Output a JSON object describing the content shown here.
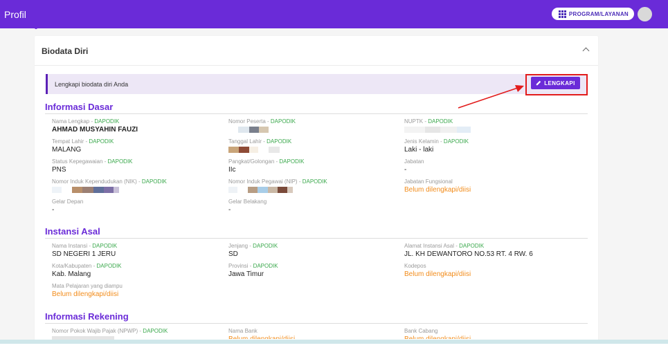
{
  "topbar": {
    "title": "Profil",
    "program_button": "PROGRAM/LAYANAN",
    "program_icon": "grid-icon",
    "avatar_icon": "avatar"
  },
  "card": {
    "title": "Biodata Diri",
    "alert_text": "Lengkapi biodata diri Anda",
    "lengkapi_label": "LENGKAPI",
    "lengkapi_icon": "pencil-icon"
  },
  "colors": {
    "primary": "#6a2bd8",
    "source_green": "#3aa84c",
    "warning_orange": "#f28c1b",
    "annotation_red": "#e21b1b"
  },
  "sections": {
    "informasi_dasar": {
      "title": "Informasi Dasar",
      "fields": {
        "nama_lengkap": {
          "label": "Nama Lengkap",
          "source": "DAPODIK",
          "value": "AHMAD MUSYAHIN FAUZI"
        },
        "nomor_peserta": {
          "label": "Nomor Peserta",
          "source": "DAPODIK",
          "value": ""
        },
        "nuptk": {
          "label": "NUPTK",
          "source": "DAPODIK",
          "value": ""
        },
        "tempat_lahir": {
          "label": "Tempat Lahir",
          "source": "DAPODIK",
          "value": "MALANG"
        },
        "tanggal_lahir": {
          "label": "Tanggal Lahir",
          "source": "DAPODIK",
          "value": ""
        },
        "jenis_kelamin": {
          "label": "Jenis Kelamin",
          "source": "DAPODIK",
          "value": "Laki - laki"
        },
        "status_kepegawaian": {
          "label": "Status Kepegawaian",
          "source": "DAPODIK",
          "value": "PNS"
        },
        "pangkat": {
          "label": "Pangkat/Golongan",
          "source": "DAPODIK",
          "value": "IIc"
        },
        "jabatan": {
          "label": "Jabatan",
          "value": "-"
        },
        "nik": {
          "label": "Nomor Induk Kependudukan (NIK)",
          "source": "DAPODIK",
          "value": ""
        },
        "nip": {
          "label": "Nomor Induk Pegawai (NIP)",
          "source": "DAPODIK",
          "value": ""
        },
        "jabatan_fungsional": {
          "label": "Jabatan Fungsional",
          "value": "Belum dilengkapi/diisi"
        },
        "gelar_depan": {
          "label": "Gelar Depan",
          "value": "-"
        },
        "gelar_belakang": {
          "label": "Gelar Belakang",
          "value": "-"
        }
      }
    },
    "instansi_asal": {
      "title": "Instansi Asal",
      "fields": {
        "nama_instansi": {
          "label": "Nama Instansi",
          "source": "DAPODIK",
          "value": "SD NEGERI 1 JERU"
        },
        "jenjang": {
          "label": "Jenjang",
          "source": "DAPODIK",
          "value": "SD"
        },
        "alamat": {
          "label": "Alamat Instansi Asal",
          "source": "DAPODIK",
          "value": "JL. KH DEWANTORO NO.53 RT. 4 RW. 6"
        },
        "kota": {
          "label": "Kota/Kabupaten",
          "source": "DAPODIK",
          "value": "Kab. Malang"
        },
        "provinsi": {
          "label": "Provinsi",
          "source": "DAPODIK",
          "value": "Jawa Timur"
        },
        "kodepos": {
          "label": "Kodepos",
          "value": "Belum dilengkapi/diisi"
        },
        "mapel": {
          "label": "Mata Pelajaran yang diampu",
          "value": "Belum dilengkapi/diisi"
        }
      }
    },
    "informasi_rekening": {
      "title": "Informasi Rekening",
      "fields": {
        "npwp": {
          "label": "Nomor Pokok Wajib Pajak (NPWP)",
          "source": "DAPODIK",
          "value": ""
        },
        "nama_bank": {
          "label": "Nama Bank",
          "value": "Belum dilengkapi/diisi"
        },
        "bank_cabang": {
          "label": "Bank Cabang",
          "value": "Belum dilengkapi/diisi"
        }
      }
    }
  }
}
